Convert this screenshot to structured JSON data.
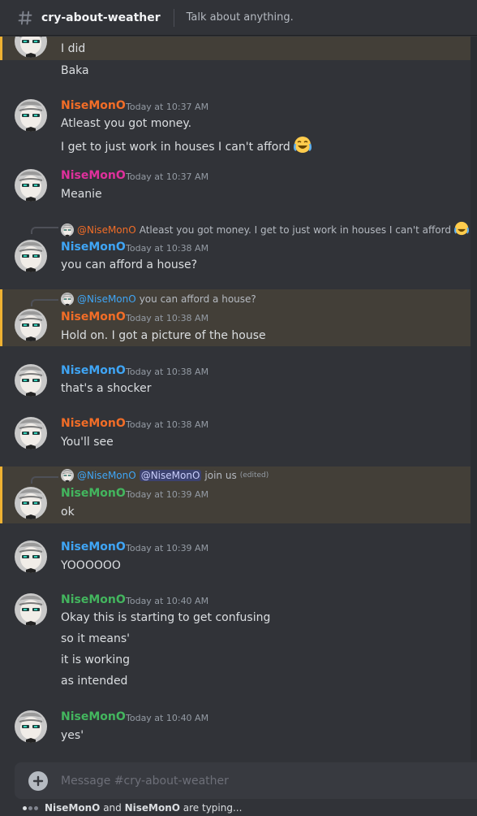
{
  "header": {
    "channel_name": "cry-about-weather",
    "topic": "Talk about anything."
  },
  "colors": {
    "orange": "#f26d27",
    "pink": "#e0309c",
    "blue": "#3fa5f5",
    "green": "#43b65e",
    "mention_bg": "#433f38",
    "mention_bar": "#f0b232"
  },
  "messages": [
    {
      "author": "",
      "timestamp": "",
      "lines": [
        "I did"
      ],
      "mention": true
    },
    {
      "author": "",
      "timestamp": "",
      "lines": [
        "Baka"
      ]
    },
    {
      "author": "NiseMonO",
      "timestamp": "Today at 10:37 AM",
      "lines": [
        "Atleast you got money.",
        "I get to just work in houses I can't afford"
      ],
      "emoji": "joy-emoji"
    },
    {
      "author": "NiseMonO",
      "timestamp": "Today at 10:37 AM",
      "lines": [
        "Meanie"
      ]
    },
    {
      "author": "NiseMonO",
      "timestamp": "Today at 10:38 AM",
      "lines": [
        "you can afford a house?"
      ],
      "reply": {
        "author": "@NiseMonO",
        "text": "Atleast you got money.  I get to just work in houses I can't afford"
      }
    },
    {
      "author": "NiseMonO",
      "timestamp": "Today at 10:38 AM",
      "lines": [
        "Hold on. I got a picture of the house"
      ],
      "mention": true,
      "reply": {
        "author": "@NiseMonO",
        "text": "you can afford a house?"
      }
    },
    {
      "author": "NiseMonO",
      "timestamp": "Today at 10:38 AM",
      "lines": [
        "that's a shocker"
      ]
    },
    {
      "author": "NiseMonO",
      "timestamp": "Today at 10:38 AM",
      "lines": [
        "You'll see"
      ]
    },
    {
      "author": "NiseMonO",
      "timestamp": "Today at 10:39 AM",
      "lines": [
        "ok"
      ],
      "mention": true,
      "reply": {
        "author": "@NiseMonO",
        "mention": "@NiseMonO",
        "text": "join us",
        "edited": "(edited)"
      }
    },
    {
      "author": "NiseMonO",
      "timestamp": "Today at 10:39 AM",
      "lines": [
        "YOOOOOO"
      ]
    },
    {
      "author": "NiseMonO",
      "timestamp": "Today at 10:40 AM",
      "lines": [
        "Okay this is starting to get confusing",
        "so it means'",
        "it is working",
        "as intended"
      ]
    },
    {
      "author": "NiseMonO",
      "timestamp": "Today at 10:40 AM",
      "lines": [
        "yes'"
      ]
    }
  ],
  "composer": {
    "placeholder": "Message #cry-about-weather"
  },
  "typing": {
    "user_a": "NiseMonO",
    "joiner": " and ",
    "user_b": "NiseMonO",
    "suffix": " are typing..."
  }
}
